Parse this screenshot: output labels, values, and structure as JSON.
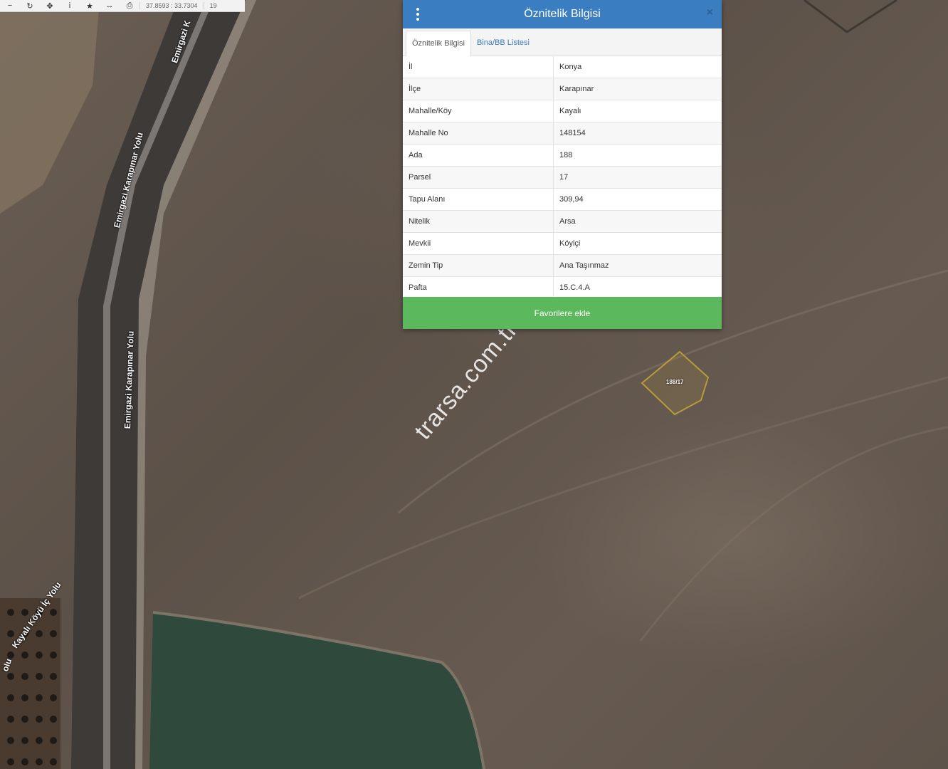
{
  "toolbar": {
    "coordinates": "37.8593 : 33.7304",
    "zoom": "19",
    "icons": [
      "minus-icon",
      "refresh-icon",
      "move-icon",
      "info-icon",
      "star-icon",
      "measure-icon",
      "print-icon"
    ]
  },
  "map": {
    "road_labels": {
      "top": "Emirgazi K",
      "upper": "Emirgazi Karapınar Yolu",
      "middle": "Emirgazi Karapınar Yolu",
      "village_road": "Kayalı Köyü İç Yolu",
      "edge": "olu"
    },
    "parcel_label": "188/17",
    "watermark": "trarsa.com.tr"
  },
  "panel": {
    "title": "Öznitelik Bilgisi",
    "close": "×",
    "tabs": {
      "active": "Öznitelik Bilgisi",
      "other": "Bina/BB Listesi"
    },
    "rows": [
      {
        "key": "İl",
        "value": "Konya"
      },
      {
        "key": "İlçe",
        "value": "Karapınar"
      },
      {
        "key": "Mahalle/Köy",
        "value": "Kayalı"
      },
      {
        "key": "Mahalle No",
        "value": "148154"
      },
      {
        "key": "Ada",
        "value": "188"
      },
      {
        "key": "Parsel",
        "value": "17"
      },
      {
        "key": "Tapu Alanı",
        "value": "309,94"
      },
      {
        "key": "Nitelik",
        "value": "Arsa"
      },
      {
        "key": "Mevkii",
        "value": "Köyiçi"
      },
      {
        "key": "Zemin Tip",
        "value": "Ana Taşınmaz"
      },
      {
        "key": "Pafta",
        "value": "15.C.4.A"
      }
    ],
    "favorite_button": "Favorilere ekle"
  },
  "colors": {
    "header": "#3a7dc0",
    "button": "#5cb85c",
    "parcel_outline": "#b89b3a"
  }
}
